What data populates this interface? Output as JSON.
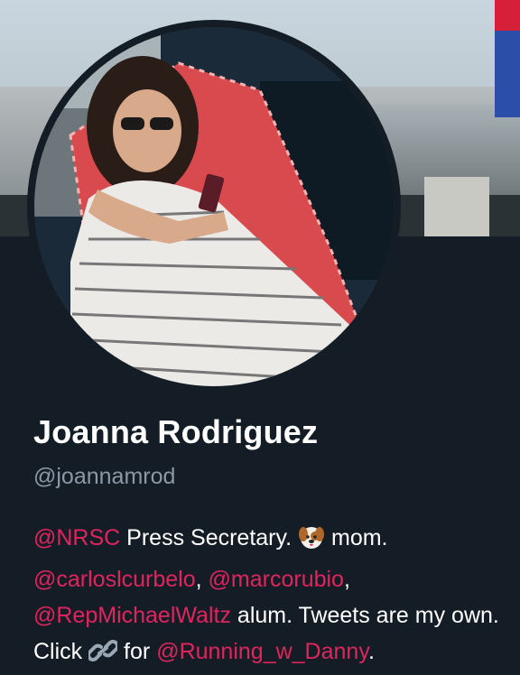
{
  "profile": {
    "name": "Joanna Rodriguez",
    "handle": "@joannamrod",
    "bio": {
      "mention_nrsc": "@NRSC",
      "text_press": " Press Secretary. ",
      "dog_emoji": "dog-face-icon",
      "text_mom": " mom.",
      "mention_curbelo": "@carloslcurbelo",
      "sep1": ", ",
      "mention_rubio": "@marcorubio",
      "sep2": ",",
      "mention_waltz": "@RepMichaelWaltz",
      "text_alum": " alum. Tweets are my own. Click ",
      "link_emoji": "link-icon",
      "text_for": " for ",
      "mention_danny": "@Running_w_Danny",
      "end": "."
    }
  },
  "colors": {
    "background": "#141d26",
    "mention": "#e0245e",
    "handle": "#8b98a5",
    "text": "#ffffff"
  }
}
